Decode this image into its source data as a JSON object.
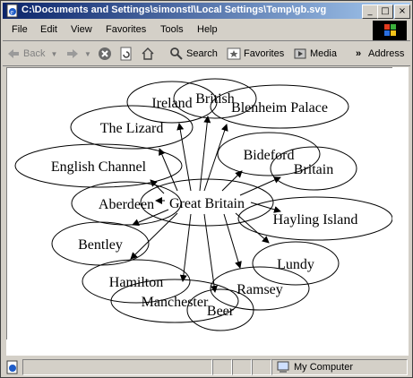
{
  "window": {
    "title": "C:\\Documents and Settings\\simonstl\\Local Settings\\Temp\\gb.svg",
    "controls": {
      "minimize": "_",
      "maximize": "□",
      "close": "×"
    }
  },
  "menu": [
    "File",
    "Edit",
    "View",
    "Favorites",
    "Tools",
    "Help"
  ],
  "toolbar": {
    "back": "Back",
    "search": "Search",
    "favorites": "Favorites",
    "media": "Media",
    "chevron": "»",
    "address": "Address"
  },
  "graph": {
    "center": "Great Britain",
    "nodes": [
      "Ireland",
      "British",
      "Blenheim Palace",
      "The Lizard",
      "Bideford",
      "English Channel",
      "Britain",
      "Aberdeen",
      "Hayling Island",
      "Bentley",
      "Lundy",
      "Hamilton",
      "Ramsey",
      "Manchester",
      "Beer"
    ]
  },
  "status": {
    "zone": "My Computer"
  },
  "colors": {
    "titlebar_start": "#0a246a",
    "titlebar_end": "#a6caf0",
    "chrome": "#d4d0c8"
  }
}
